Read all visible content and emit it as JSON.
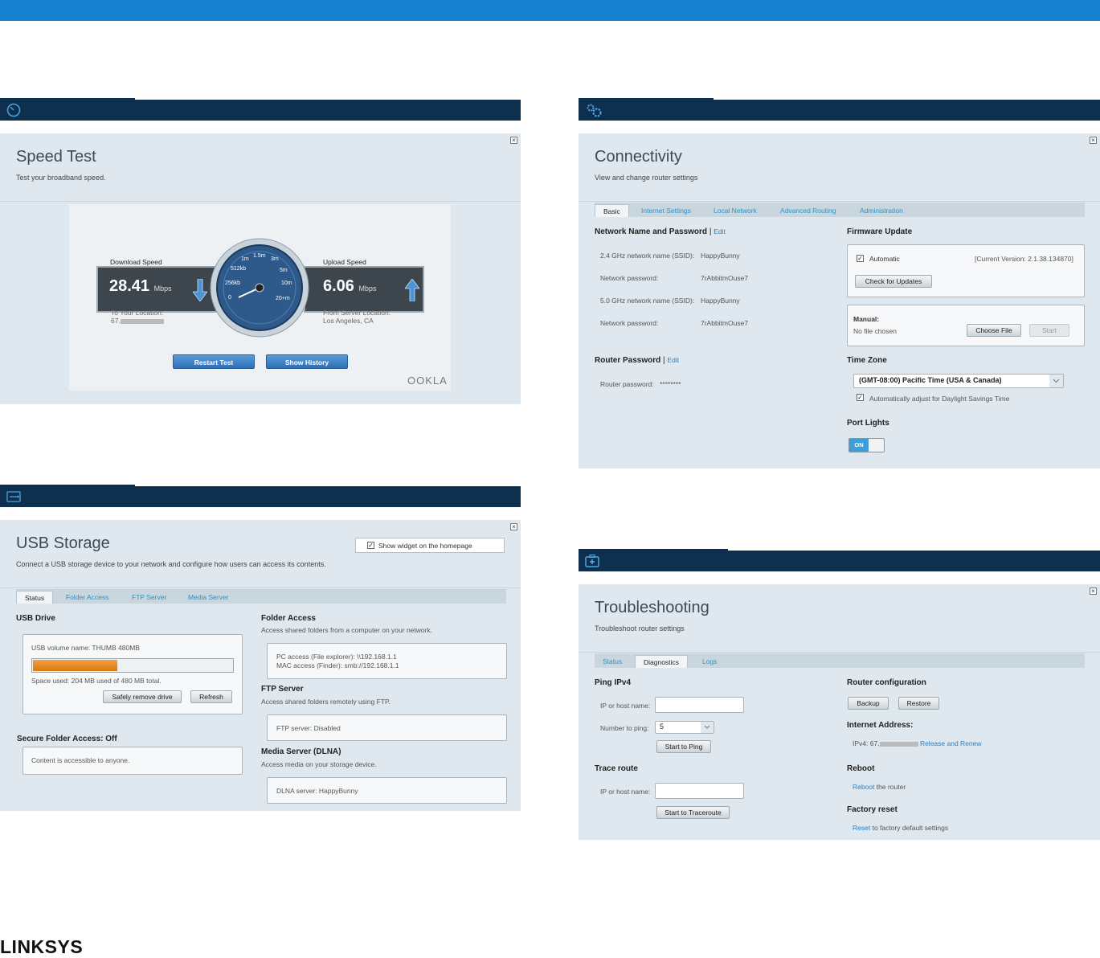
{
  "speed_test": {
    "title": "Speed Test",
    "subtitle": "Test your broadband speed.",
    "download_label": "Download Speed",
    "download_value": "28.41",
    "download_unit": "Mbps",
    "download_location_label": "To Your Location:",
    "download_location_value": "67.",
    "upload_label": "Upload Speed",
    "upload_value": "6.06",
    "upload_unit": "Mbps",
    "upload_location_label": "From Server Location:",
    "upload_location_value": "Los Angeles, CA",
    "gauge_labels": [
      "0",
      "256kb",
      "512kb",
      "1m",
      "1.5m",
      "3m",
      "5m",
      "10m",
      "20+m"
    ],
    "restart_label": "Restart Test",
    "history_label": "Show History",
    "brand": "OOKLA"
  },
  "usb_storage": {
    "title": "USB Storage",
    "subtitle": "Connect a USB storage device to your network and configure how users can access its contents.",
    "show_widget_label": "Show widget on the homepage",
    "tabs": [
      "Status",
      "Folder Access",
      "FTP Server",
      "Media Server"
    ],
    "usb_drive_title": "USB Drive",
    "volume_name": "USB volume name: THUMB 480MB",
    "usage_fraction": 0.425,
    "space_used": "Space used: 204 MB used of 480 MB total.",
    "safely_remove_label": "Safely remove drive",
    "refresh_label": "Refresh",
    "secure_title": "Secure Folder Access: Off",
    "secure_text": "Content is accessible to anyone.",
    "folder_access_title": "Folder Access",
    "folder_access_sub": "Access shared folders from a computer on your network.",
    "pc_access": "PC access (File explorer): \\\\192.168.1.1",
    "mac_access": "MAC access (Finder): smb://192.168.1.1",
    "ftp_title": "FTP Server",
    "ftp_sub": "Access shared folders remotely using FTP.",
    "ftp_status": "FTP server: Disabled",
    "dlna_title": "Media Server (DLNA)",
    "dlna_sub": "Access media on your storage device.",
    "dlna_status": "DLNA server: HappyBunny"
  },
  "connectivity": {
    "title": "Connectivity",
    "subtitle": "View and change router settings",
    "tabs": [
      "Basic",
      "Internet Settings",
      "Local Network",
      "Advanced Routing",
      "Administration"
    ],
    "network_title": "Network Name and Password",
    "edit_label": "Edit",
    "ssid24_label": "2.4 GHz network name (SSID):",
    "ssid24_value": "HappyBunny",
    "pw1_label": "Network password:",
    "pw1_value": "7rAbbitmOuse7",
    "ssid5_label": "5.0 GHz network name (SSID):",
    "ssid5_value": "HappyBunny",
    "pw2_label": "Network password:",
    "pw2_value": "7rAbbitmOuse7",
    "router_pw_title": "Router Password",
    "router_pw_label": "Router password:",
    "router_pw_value": "********",
    "firmware_title": "Firmware Update",
    "automatic_label": "Automatic",
    "current_version": "[Current Version: 2.1.38.134870]",
    "check_updates_label": "Check for Updates",
    "manual_label": "Manual:",
    "no_file": "No file chosen",
    "choose_file_label": "Choose File",
    "start_label": "Start",
    "timezone_title": "Time Zone",
    "timezone_value": "(GMT-08:00) Pacific Time (USA & Canada)",
    "dst_label": "Automatically adjust for Daylight Savings Time",
    "port_lights_title": "Port Lights",
    "toggle_on": "ON"
  },
  "troubleshooting": {
    "title": "Troubleshooting",
    "subtitle": "Troubleshoot router settings",
    "tabs": [
      "Status",
      "Diagnostics",
      "Logs"
    ],
    "ping_title": "Ping IPv4",
    "ip_host_label": "IP or host name:",
    "number_to_ping_label": "Number to ping:",
    "number_to_ping_value": "5",
    "start_ping_label": "Start to Ping",
    "trace_title": "Trace route",
    "trace_ip_label": "IP or host name:",
    "start_trace_label": "Start to Traceroute",
    "router_config_title": "Router configuration",
    "backup_label": "Backup",
    "restore_label": "Restore",
    "internet_address_title": "Internet Address:",
    "ipv4_prefix": "IPv4: 67.",
    "release_renew_label": "Release and Renew",
    "reboot_title": "Reboot",
    "reboot_link": "Reboot",
    "reboot_text": " the router",
    "factory_title": "Factory reset",
    "reset_link": "Reset",
    "reset_text": " to factory default settings"
  },
  "footer": {
    "logo": "LINKSYS"
  },
  "colors": {
    "topbar": "#1480cf",
    "header": "#0f2f4f",
    "panel": "#dfe8ee",
    "link": "#2a7ec2",
    "usage": "#e28a20"
  }
}
